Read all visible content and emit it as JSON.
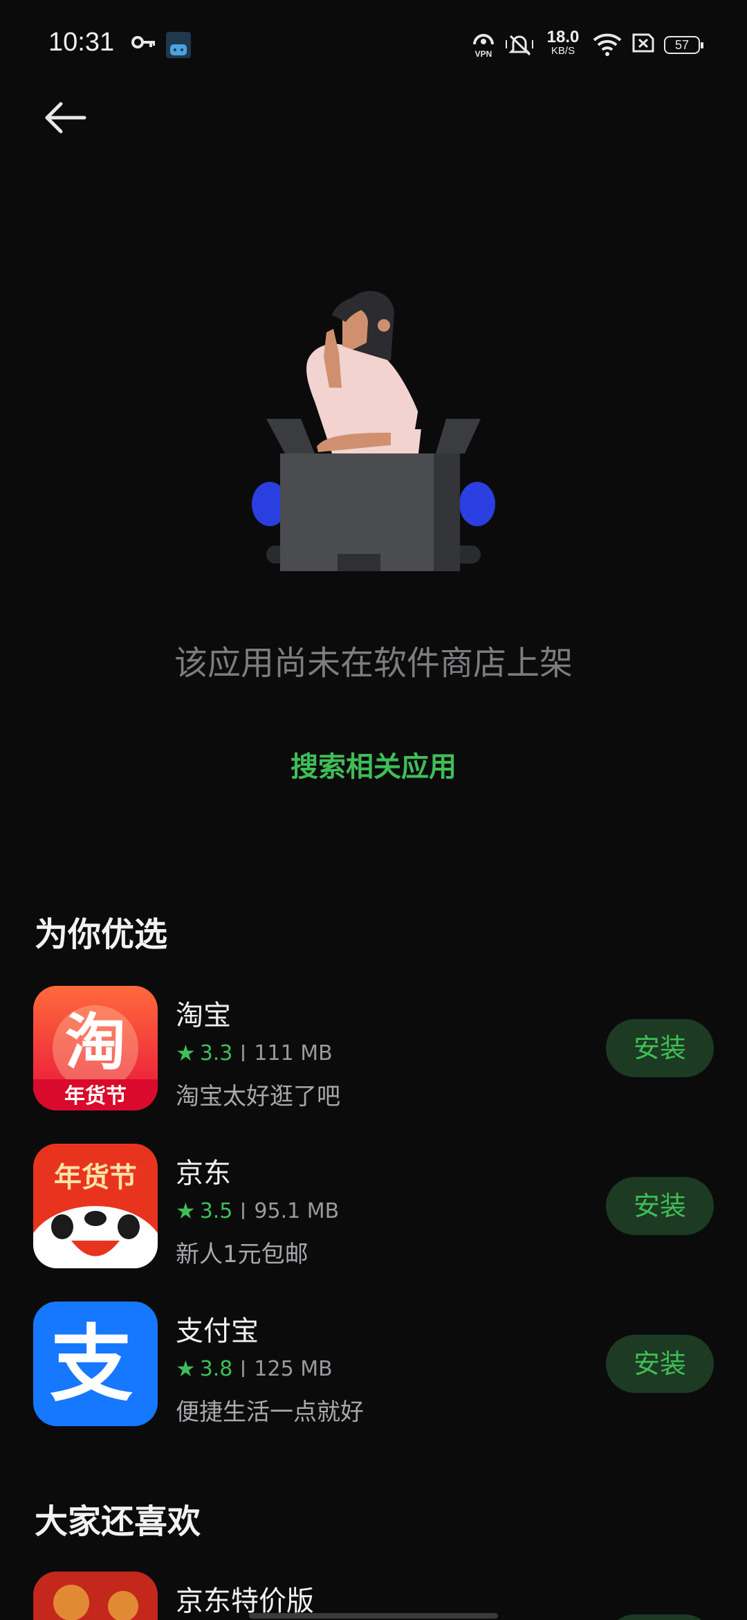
{
  "status_bar": {
    "time": "10:31",
    "network_speed_value": "18.0",
    "network_speed_unit": "KB/S",
    "battery": "57",
    "icons": [
      "key-icon",
      "bilibili-icon",
      "vpn-icon",
      "mute-icon",
      "wifi-icon",
      "sim-icon",
      "battery-icon"
    ],
    "vpn_label": "VPN",
    "bili_label": "blublu"
  },
  "empty_state": {
    "message": "该应用尚未在软件商店上架",
    "search_link": "搜索相关应用"
  },
  "section1": {
    "title": "为你优选",
    "apps": [
      {
        "name": "淘宝",
        "rating": "3.3",
        "size": "111 MB",
        "desc": "淘宝太好逛了吧",
        "button": "安装",
        "icon_text": "淘",
        "icon_sub": "年货节"
      },
      {
        "name": "京东",
        "rating": "3.5",
        "size": "95.1 MB",
        "desc": "新人1元包邮",
        "button": "安装",
        "icon_text": "年货节"
      },
      {
        "name": "支付宝",
        "rating": "3.8",
        "size": "125 MB",
        "desc": "便捷生活一点就好",
        "button": "安装",
        "icon_text": "支"
      }
    ]
  },
  "section2": {
    "title": "大家还喜欢",
    "apps": [
      {
        "name": "京东特价版"
      }
    ]
  },
  "colors": {
    "background": "#0b0b0c",
    "accent_green": "#3fbe57",
    "button_bg": "#1d3a22",
    "muted_text": "#7d7d80"
  }
}
